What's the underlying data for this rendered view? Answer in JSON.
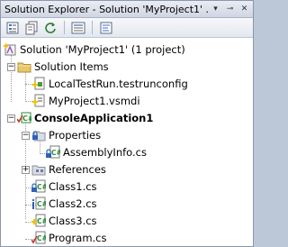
{
  "window": {
    "title": "Solution Explorer - Solution 'MyProject1' ...",
    "dropdown_glyph": "▾",
    "pin_glyph": "⊸",
    "close_glyph": "✕"
  },
  "toolbar": {
    "buttons": [
      {
        "name": "properties-icon"
      },
      {
        "name": "show-all-files-icon"
      },
      {
        "name": "refresh-icon"
      },
      {
        "name": "view-class-diagram-icon"
      },
      {
        "name": "view-code-icon"
      }
    ]
  },
  "tree": {
    "solution": "Solution 'MyProject1' (1 project)",
    "solution_items": "Solution Items",
    "testrunconfig": "LocalTestRun.testrunconfig",
    "vsmdi": "MyProject1.vsmdi",
    "project": "ConsoleApplication1",
    "properties": "Properties",
    "assemblyinfo": "AssemblyInfo.cs",
    "references": "References",
    "class1": "Class1.cs",
    "class2": "Class2.cs",
    "class3": "Class3.cs",
    "program": "Program.cs"
  },
  "colors": {
    "titlebar": "#cfd6e3",
    "csharp_file": "#2e8b3a",
    "folder": "#e8c66a",
    "checkin_plus": "#f2c200",
    "checkout_check": "#c0392b",
    "lock_blue": "#2c62b8"
  }
}
